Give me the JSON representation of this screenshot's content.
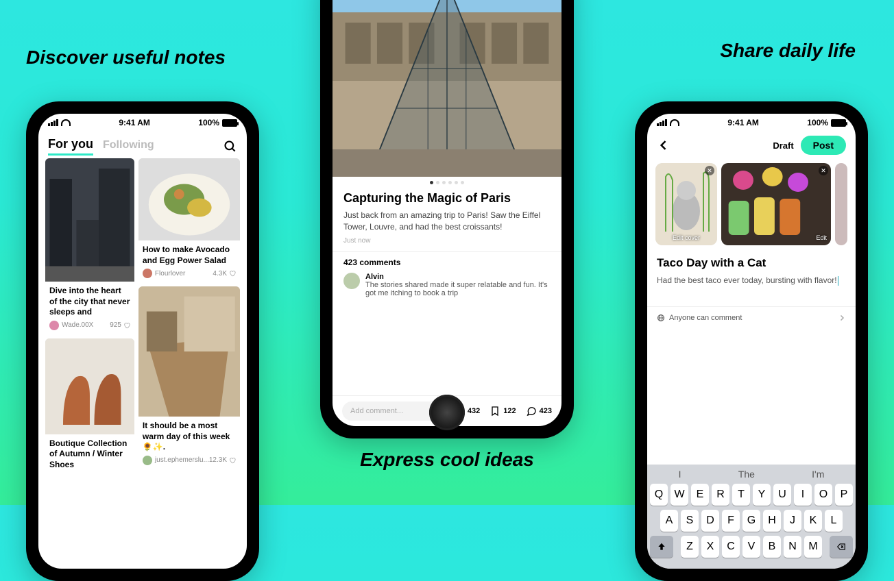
{
  "headlines": {
    "discover": "Discover useful notes",
    "express": "Express cool ideas",
    "share": "Share daily life"
  },
  "status": {
    "time": "9:41 AM",
    "battery": "100%"
  },
  "phone1": {
    "tabs": {
      "active": "For you",
      "inactive": "Following"
    },
    "cards": [
      {
        "title": "Dive into the heart of the city that never sleeps and",
        "author": "Wade.00X",
        "likes": "925"
      },
      {
        "title": "How to make Avocado and Egg Power Salad",
        "author": "Flourlover",
        "likes": "4.3K"
      },
      {
        "title": "Boutique Collection of Autumn / Winter Shoes",
        "author": "",
        "likes": ""
      },
      {
        "title": "It should be a most warm day of this week 🌻✨.",
        "author": "just.ephemerslu...",
        "likes": "12.3K"
      }
    ]
  },
  "phone2": {
    "title": "Capturing the Magic of Paris",
    "body": "Just back from an amazing trip to Paris! Saw the Eiffel Tower, Louvre, and had the best croissants!",
    "time": "Just now",
    "comments_label": "423 comments",
    "comment": {
      "name": "Alvin",
      "text": "The stories shared made it super relatable and fun. It's got me itching to book a trip"
    },
    "add_placeholder": "Add comment...",
    "stats": {
      "likes": "432",
      "saves": "122",
      "replies": "423"
    }
  },
  "phone3": {
    "draft": "Draft",
    "post": "Post",
    "pic1_tag": "Edit cover",
    "pic2_tag": "Edit",
    "title": "Taco Day with a Cat",
    "body": "Had the best taco ever today, bursting with flavor!",
    "privacy": "Anyone can comment",
    "suggest": [
      "I",
      "The",
      "I'm"
    ],
    "rows": [
      [
        "Q",
        "W",
        "E",
        "R",
        "T",
        "Y",
        "U",
        "I",
        "O",
        "P"
      ],
      [
        "A",
        "S",
        "D",
        "F",
        "G",
        "H",
        "J",
        "K",
        "L"
      ],
      [
        "Z",
        "X",
        "C",
        "V",
        "B",
        "N",
        "M"
      ]
    ]
  }
}
